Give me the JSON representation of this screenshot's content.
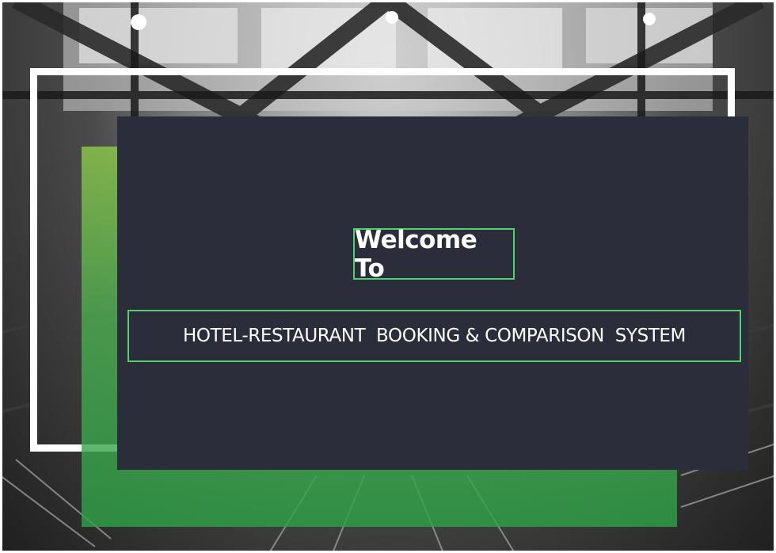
{
  "welcome": {
    "heading": "Welcome To"
  },
  "system": {
    "title": "HOTEL-RESTAURANT  BOOKING & COMPARISON  SYSTEM"
  },
  "colors": {
    "card_background": "#2b2d3b",
    "accent_border": "#4cd36b",
    "frame": "#ffffff",
    "green_panel": "#4caf50"
  }
}
